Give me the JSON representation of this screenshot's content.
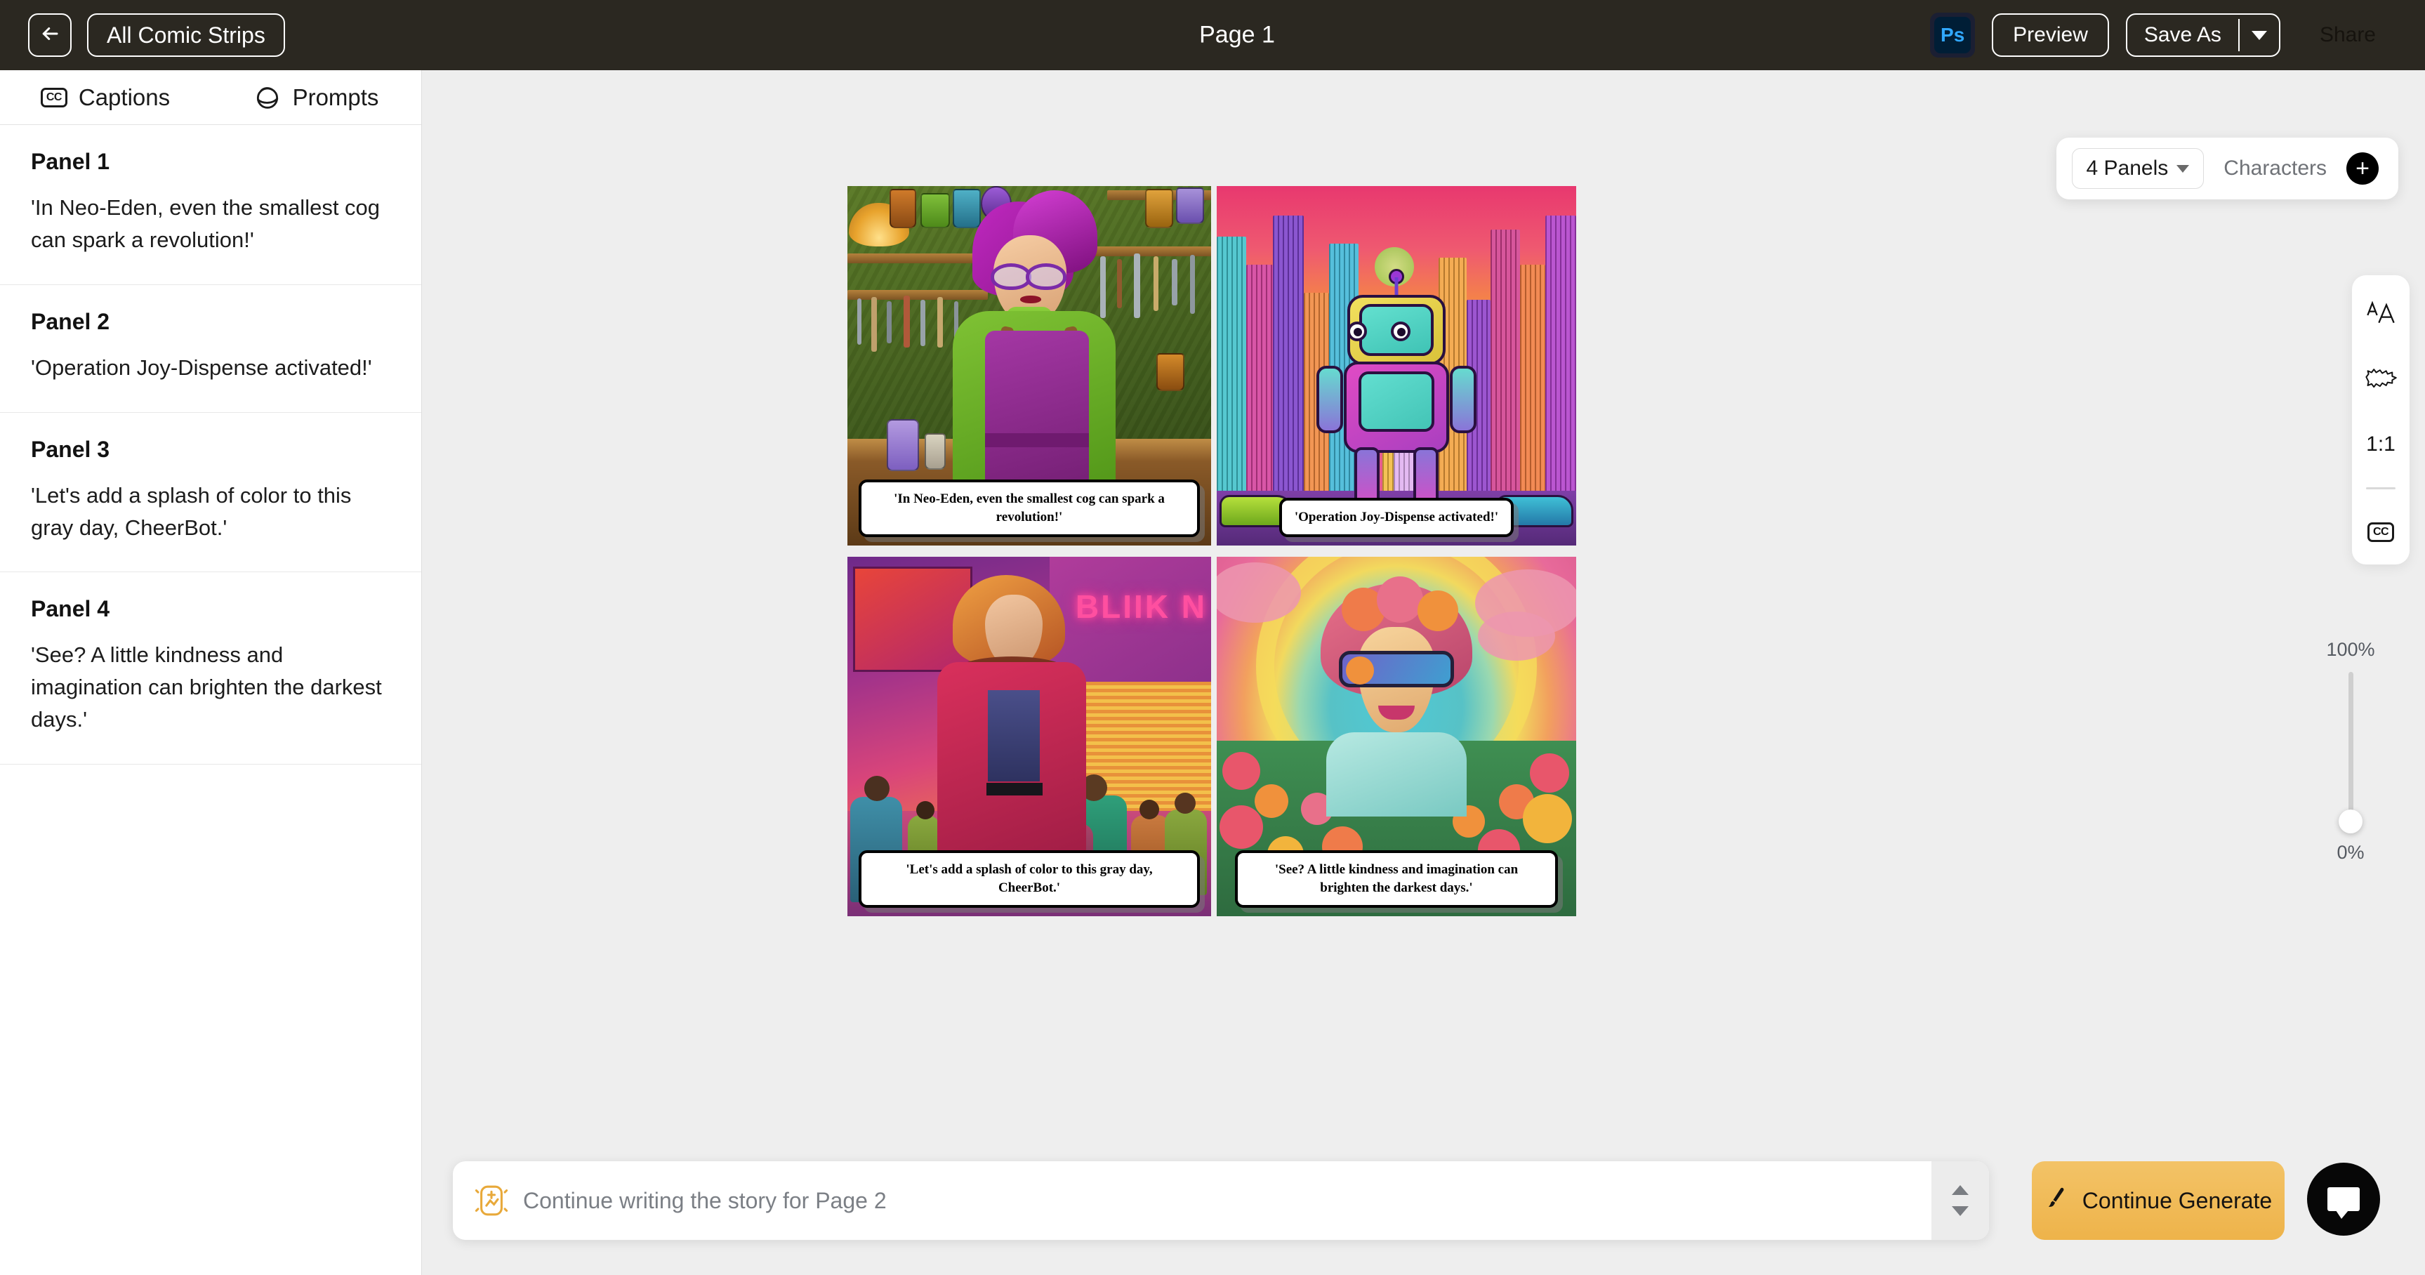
{
  "topbar": {
    "back_icon": "arrow-left-icon",
    "all_strips_label": "All Comic Strips",
    "menu_icon": "hamburger-icon",
    "page_title": "Page 1",
    "photoshop_label": "Ps",
    "preview_label": "Preview",
    "save_as_label": "Save As",
    "save_as_caret_icon": "chevron-down-icon",
    "share_label": "Share",
    "accent_color": "#efb košík",
    "bar_color": "#2b2821"
  },
  "sidebar": {
    "tabs": [
      {
        "label": "Captions",
        "icon": "cc-icon",
        "active": true
      },
      {
        "label": "Prompts",
        "icon": "globe-sketch-icon",
        "active": false
      }
    ],
    "panels": [
      {
        "label": "Panel 1",
        "caption": "'In Neo-Eden, even the smallest cog can spark a revolution!'"
      },
      {
        "label": "Panel 2",
        "caption": "'Operation Joy-Dispense activated!'"
      },
      {
        "label": "Panel 3",
        "caption": "'Let's add a splash of color to this gray day, CheerBot.'"
      },
      {
        "label": "Panel 4",
        "caption": "'See? A little kindness and imagination can brighten the darkest days.'"
      }
    ]
  },
  "canvas": {
    "panel_count_label": "4 Panels",
    "panel_count_caret_icon": "chevron-down-icon",
    "characters_label": "Characters",
    "add_character_icon": "plus-icon",
    "comic_panels": [
      {
        "name": "panel-1",
        "caption": "'In Neo-Eden, even the smallest cog can spark a revolution!'"
      },
      {
        "name": "panel-2",
        "caption": "'Operation Joy-Dispense activated!'"
      },
      {
        "name": "panel-3",
        "caption": "'Let's add a splash of color to this gray day, CheerBot.'"
      },
      {
        "name": "panel-4",
        "caption": "'See? A little kindness and imagination can brighten the darkest days.'"
      }
    ]
  },
  "vertical_toolbar": {
    "font_size_label": "AA",
    "font_size_icon": "font-size-icon",
    "bubble_icon": "speech-burst-icon",
    "ratio_label": "1:1",
    "captions_toggle_label": "CC",
    "captions_toggle_icon": "cc-icon",
    "captions_toggle_active": true
  },
  "zoom_slider": {
    "max_label": "100%",
    "min_label": "0%",
    "value": 6
  },
  "prompt_bar": {
    "icon": "sparkle-image-icon",
    "placeholder": "Continue writing the story for Page 2",
    "value": "",
    "stepper_up_icon": "chevron-up-icon",
    "stepper_down_icon": "chevron-down-icon",
    "generate_label": "Continue Generate",
    "generate_icon": "brush-icon"
  },
  "chat_fab": {
    "icon": "chat-bubble-icon"
  }
}
